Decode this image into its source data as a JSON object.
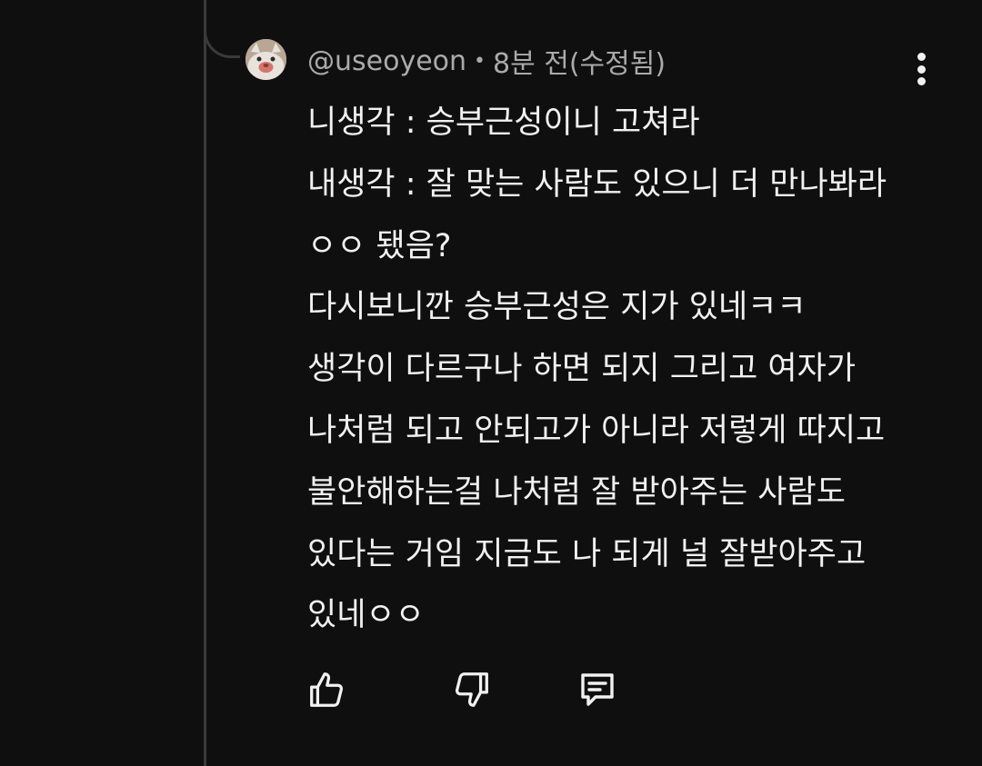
{
  "comment": {
    "author": "@useoyeon",
    "separator": "•",
    "time": "8분 전(수정됨)",
    "lines": [
      "니생각 : 승부근성이니 고쳐라",
      "내생각 : 잘 맞는 사람도 있으니 더 만나봐라",
      "ㅇㅇ 됐음?",
      "다시보니깐 승부근성은 지가 있네ㅋㅋ",
      "생각이 다르구나 하면 되지 그리고 여자가",
      "나처럼 되고 안되고가 아니라 저렇게 따지고",
      "불안해하는걸 나처럼 잘 받아주는 사람도",
      "있다는 거임 지금도 나 되게 널 잘받아주고",
      "있네ㅇㅇ"
    ]
  },
  "icons": {
    "avatar": "cat-avatar",
    "more": "more-vertical-icon",
    "like": "thumbs-up-icon",
    "dislike": "thumbs-down-icon",
    "reply": "reply-comment-icon"
  },
  "colors": {
    "background": "#0f0f0f",
    "text": "#f1f1f1",
    "meta_text": "#aaaaaa",
    "thread_line": "#3a3a3a"
  }
}
